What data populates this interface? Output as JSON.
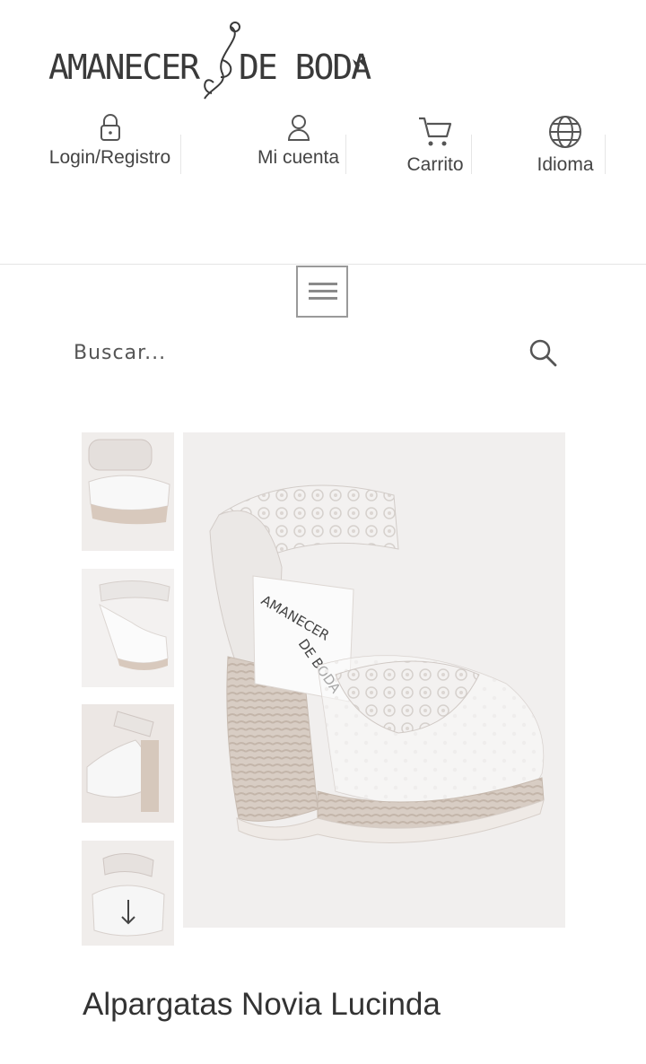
{
  "brand": {
    "logo_left": "AMANECER",
    "logo_right": "DE BODA"
  },
  "nav": {
    "login": "Login/Registro",
    "account": "Mi cuenta",
    "cart": "Carrito",
    "language": "Idioma"
  },
  "icons": {
    "login": "lock-icon",
    "account": "user-icon",
    "cart": "cart-icon",
    "language": "globe-icon",
    "menu": "hamburger-menu-icon",
    "search": "search-icon",
    "scroll": "arrow-down-icon"
  },
  "search": {
    "placeholder": "Buscar..."
  },
  "product": {
    "title": "Alpargatas Novia Lucinda",
    "box_brand_line1": "AMANECER",
    "box_brand_line2": "DE BODA"
  },
  "colors": {
    "text": "#333333",
    "nav_text": "#444444",
    "border": "#e5e5e5",
    "image_bg": "#f1efee"
  }
}
